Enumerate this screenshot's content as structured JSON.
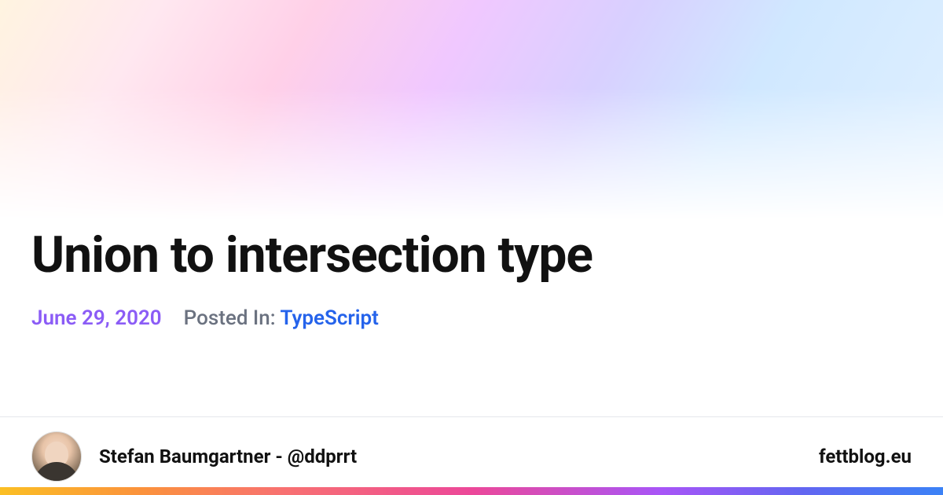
{
  "post": {
    "title": "Union to intersection type",
    "date": "June 29, 2020",
    "posted_in_label": "Posted In:",
    "category": "TypeScript"
  },
  "author": {
    "name": "Stefan Baumgartner - @ddprrt"
  },
  "site": {
    "name": "fettblog.eu"
  }
}
